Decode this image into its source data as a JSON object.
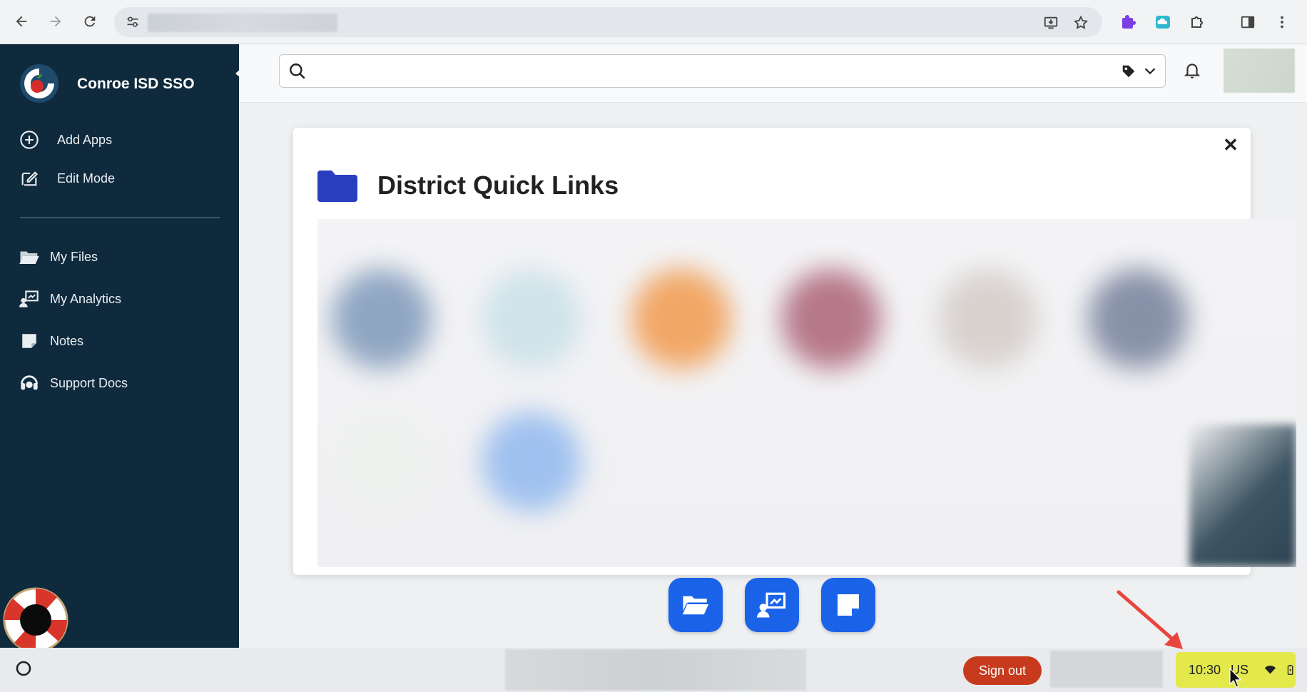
{
  "browser": {
    "back_icon": "arrow-left-icon",
    "forward_icon": "arrow-right-icon",
    "reload_icon": "reload-icon",
    "site_info_icon": "tune-icon",
    "install_icon": "install-app-icon",
    "bookmark_icon": "star-icon",
    "extensions": [
      "puzzle-purple-icon",
      "cloud-teal-icon",
      "puzzle-icon"
    ],
    "sidepanel_icon": "side-panel-icon",
    "menu_icon": "more-vert-icon"
  },
  "sidebar": {
    "brand": "Conroe ISD SSO",
    "top_items": [
      {
        "label": "Add Apps",
        "icon": "plus-circle-icon"
      },
      {
        "label": "Edit Mode",
        "icon": "edit-icon"
      }
    ],
    "items": [
      {
        "label": "My Files",
        "icon": "folder-open-icon"
      },
      {
        "label": "My Analytics",
        "icon": "analytics-icon"
      },
      {
        "label": "Notes",
        "icon": "note-icon"
      },
      {
        "label": "Support Docs",
        "icon": "support-icon"
      }
    ]
  },
  "topbar": {
    "search_placeholder": "",
    "search_value": ""
  },
  "modal": {
    "title": "District Quick Links",
    "close_label": "✕"
  },
  "dock": [
    "folder-open-icon",
    "analytics-icon",
    "note-icon"
  ],
  "shelf": {
    "sign_out": "Sign out",
    "time": "10:30",
    "region": "US"
  },
  "colors": {
    "sidebar_bg": "#0f2a3d",
    "accent_blue": "#1a63e8",
    "folder_blue": "#2a3fbf",
    "signout_red": "#c73a1d",
    "tray_highlight": "#e3e94a"
  }
}
